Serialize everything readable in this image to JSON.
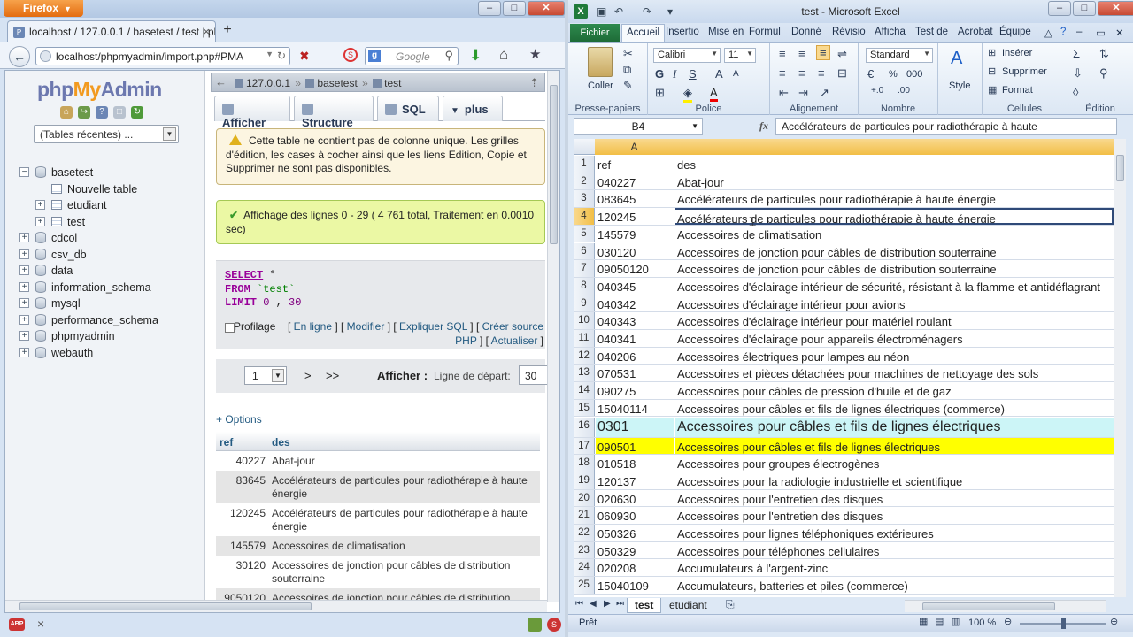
{
  "firefox": {
    "menu_label": "Firefox",
    "tab_title": "localhost / 127.0.0.1 / basetest / test | ph...",
    "url": "localhost/phpmyadmin/import.php#PMA",
    "search_placeholder": "Google",
    "new_tab_symbol": "+"
  },
  "pma": {
    "logo": {
      "php": "php",
      "my": "My",
      "admin": "Admin"
    },
    "recent_tables": "(Tables récentes) ...",
    "tree": [
      {
        "label": "basetest",
        "type": "db",
        "toggle": "−",
        "indent": 0
      },
      {
        "label": "Nouvelle table",
        "type": "table",
        "toggle": "",
        "indent": 1
      },
      {
        "label": "etudiant",
        "type": "table",
        "toggle": "+",
        "indent": 1
      },
      {
        "label": "test",
        "type": "table",
        "toggle": "+",
        "indent": 1
      },
      {
        "label": "cdcol",
        "type": "db",
        "toggle": "+",
        "indent": 0
      },
      {
        "label": "csv_db",
        "type": "db",
        "toggle": "+",
        "indent": 0
      },
      {
        "label": "data",
        "type": "db",
        "toggle": "+",
        "indent": 0
      },
      {
        "label": "information_schema",
        "type": "db",
        "toggle": "+",
        "indent": 0
      },
      {
        "label": "mysql",
        "type": "db",
        "toggle": "+",
        "indent": 0
      },
      {
        "label": "performance_schema",
        "type": "db",
        "toggle": "+",
        "indent": 0
      },
      {
        "label": "phpmyadmin",
        "type": "db",
        "toggle": "+",
        "indent": 0
      },
      {
        "label": "webauth",
        "type": "db",
        "toggle": "+",
        "indent": 0
      }
    ],
    "breadcrumb": {
      "server": "127.0.0.1",
      "db": "basetest",
      "table": "test"
    },
    "tabs": [
      "Afficher",
      "Structure",
      "SQL",
      "plus"
    ],
    "notice": "Cette table ne contient pas de colonne unique. Les grilles d'édition, les cases à cocher ainsi que les liens Edition, Copie et Supprimer ne sont pas disponibles.",
    "success": "Affichage des lignes 0 - 29 ( 4  761 total, Traitement en 0.0010 sec)",
    "sql": {
      "select": "SELECT",
      "star": " *",
      "from": "FROM",
      "table": " `test`",
      "limit": "LIMIT",
      "offset": " 0",
      "comma": " , ",
      "count": "30"
    },
    "links": {
      "profilage": "Profilage",
      "en_ligne": "En ligne",
      "modifier": "Modifier",
      "expliquer": "Expliquer SQL",
      "creer": "Créer source PHP",
      "actualiser": "Actualiser"
    },
    "pager": {
      "page": "1",
      "next": ">",
      "last": ">>",
      "afficher": "Afficher :",
      "start_label": "Ligne de départ:",
      "start_value": "30"
    },
    "options": "+ Options",
    "columns": [
      "ref",
      "des"
    ],
    "rows": [
      {
        "ref": "40227",
        "des": "Abat-jour"
      },
      {
        "ref": "83645",
        "des": "Accélérateurs de particules pour radiothérapie à haute énergie"
      },
      {
        "ref": "120245",
        "des": "Accélérateurs de particules pour radiothérapie à haute énergie"
      },
      {
        "ref": "145579",
        "des": "Accessoires de climatisation"
      },
      {
        "ref": "30120",
        "des": "Accessoires de jonction pour câbles de distribution souterraine"
      },
      {
        "ref": "9050120",
        "des": "Accessoires de jonction pour câbles de distribution"
      }
    ]
  },
  "excel": {
    "title": "test - Microsoft Excel",
    "fichier": "Fichier",
    "tabs": [
      "Accueil",
      "Insertio",
      "Mise en",
      "Formul",
      "Donné",
      "Révisio",
      "Afficha",
      "Test de",
      "Acrobat",
      "Équipe"
    ],
    "ribbon": {
      "coller": "Coller",
      "presse": "Presse-papiers",
      "font": "Calibri",
      "size": "11",
      "police": "Police",
      "alignement": "Alignement",
      "number_format": "Standard",
      "nombre": "Nombre",
      "style": "Style",
      "inserer": "Insérer",
      "supprimer": "Supprimer",
      "format": "Format",
      "cellules": "Cellules",
      "edition": "Édition",
      "percent": "%",
      "thousands": "000"
    },
    "namebox": "B4",
    "fx": "fx",
    "formula": "Accélérateurs de particules pour radiothérapie à haute",
    "col_a": "A",
    "rows": [
      {
        "n": "1",
        "a": "ref",
        "b": "des",
        "style": ""
      },
      {
        "n": "2",
        "a": "040227",
        "b": "Abat-jour",
        "style": ""
      },
      {
        "n": "3",
        "a": "083645",
        "b": "Accélérateurs de particules pour radiothérapie à haute énergie",
        "style": ""
      },
      {
        "n": "4",
        "a": "120245",
        "b": "Accélérateurs de particules pour radiothérapie à haute énergie",
        "style": "sel"
      },
      {
        "n": "5",
        "a": "145579",
        "b": "Accessoires de climatisation",
        "style": ""
      },
      {
        "n": "6",
        "a": "030120",
        "b": "Accessoires de jonction pour câbles de distribution souterraine",
        "style": ""
      },
      {
        "n": "7",
        "a": "09050120",
        "b": "Accessoires de jonction pour câbles de distribution souterraine",
        "style": ""
      },
      {
        "n": "8",
        "a": "040345",
        "b": "Accessoires d'éclairage intérieur de sécurité, résistant à la flamme et antidéflagrant",
        "style": ""
      },
      {
        "n": "9",
        "a": "040342",
        "b": "Accessoires d'éclairage intérieur pour avions",
        "style": ""
      },
      {
        "n": "10",
        "a": "040343",
        "b": "Accessoires d'éclairage intérieur pour matériel roulant",
        "style": ""
      },
      {
        "n": "11",
        "a": "040341",
        "b": "Accessoires d'éclairage pour appareils électroménagers",
        "style": ""
      },
      {
        "n": "12",
        "a": "040206",
        "b": "Accessoires électriques pour lampes au néon",
        "style": ""
      },
      {
        "n": "13",
        "a": "070531",
        "b": "Accessoires et pièces détachées pour machines de nettoyage des sols",
        "style": ""
      },
      {
        "n": "14",
        "a": "090275",
        "b": "Accessoires pour câbles de pression d'huile et de gaz",
        "style": ""
      },
      {
        "n": "15",
        "a": "15040114",
        "b": "Accessoires pour câbles et fils de lignes électriques (commerce)",
        "style": ""
      },
      {
        "n": "16",
        "a": "0301",
        "b": "Accessoires pour câbles et fils de lignes électriques",
        "style": "big"
      },
      {
        "n": "17",
        "a": "090501",
        "b": "Accessoires pour câbles et fils de lignes électriques",
        "style": "hl"
      },
      {
        "n": "18",
        "a": "010518",
        "b": "Accessoires pour groupes électrogènes",
        "style": ""
      },
      {
        "n": "19",
        "a": "120137",
        "b": "Accessoires pour la radiologie industrielle et scientifique",
        "style": ""
      },
      {
        "n": "20",
        "a": "020630",
        "b": "Accessoires pour l'entretien des disques",
        "style": ""
      },
      {
        "n": "21",
        "a": "060930",
        "b": "Accessoires pour l'entretien des disques",
        "style": ""
      },
      {
        "n": "22",
        "a": "050326",
        "b": "Accessoires pour lignes téléphoniques extérieures",
        "style": ""
      },
      {
        "n": "23",
        "a": "050329",
        "b": "Accessoires pour téléphones cellulaires",
        "style": ""
      },
      {
        "n": "24",
        "a": "020208",
        "b": "Accumulateurs à l'argent-zinc",
        "style": ""
      },
      {
        "n": "25",
        "a": "15040109",
        "b": "Accumulateurs, batteries et piles (commerce)",
        "style": ""
      }
    ],
    "sheets": [
      "test",
      "etudiant"
    ],
    "status": "Prêt",
    "zoom": "100 %"
  }
}
